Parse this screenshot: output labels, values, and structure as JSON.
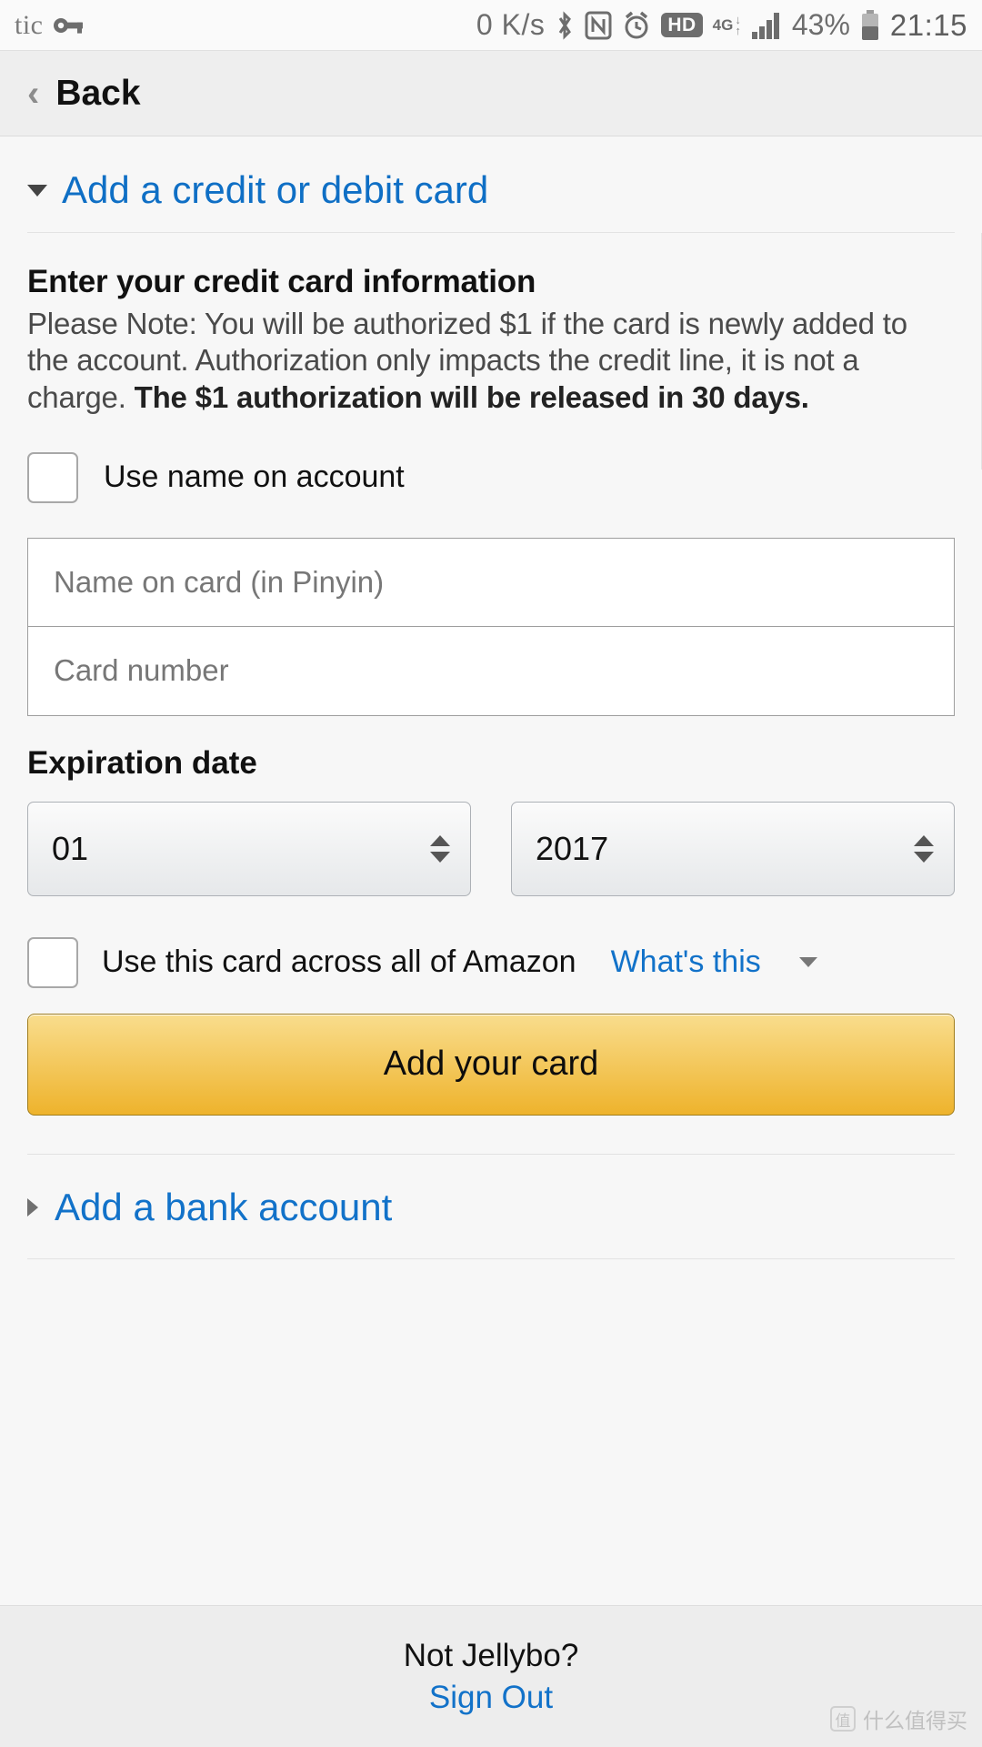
{
  "statusbar": {
    "carrier": "tic",
    "key_icon": "key-icon",
    "network_speed": "0 K/s",
    "bluetooth_icon": "bluetooth-icon",
    "nfc_icon": "nfc-icon",
    "alarm_icon": "alarm-clock-icon",
    "hd_badge": "HD",
    "network_type": "4G",
    "network_arrows": "↓↑",
    "signal_icon": "signal-bars-icon",
    "battery_percent": "43%",
    "battery_icon": "battery-icon",
    "time": "21:15"
  },
  "header": {
    "back_label": "Back",
    "back_icon": "chevron-left-icon"
  },
  "section": {
    "expand_icon": "triangle-down-icon",
    "title": "Add a credit or debit card"
  },
  "form": {
    "heading": "Enter your credit card information",
    "note_plain": "Please Note: You will be authorized $1 if the card is newly added to the account. Authorization only impacts the credit line, it is not a charge. ",
    "note_bold": "The $1 authorization will be released in 30 days.",
    "use_name_checkbox_label": "Use name on account",
    "name_placeholder": "Name on card (in Pinyin)",
    "card_number_placeholder": "Card number",
    "expiration_label": "Expiration date",
    "expiration_month": "01",
    "expiration_year": "2017",
    "across_amazon_label": "Use this card across all of Amazon",
    "whats_this_link": "What's this",
    "submit_label": "Add your card"
  },
  "bank": {
    "expand_icon": "triangle-right-icon",
    "link": "Add a bank account"
  },
  "footer": {
    "not_user": "Not Jellybo?",
    "sign_out": "Sign Out"
  },
  "watermark": {
    "badge": "值",
    "text": "什么值得买"
  },
  "colors": {
    "link_blue": "#1272c9",
    "section_blue": "#0f6fc5",
    "cta_gold_top": "#f9dd8d",
    "cta_gold_bottom": "#eeb32c",
    "page_bg": "#f7f7f7"
  }
}
